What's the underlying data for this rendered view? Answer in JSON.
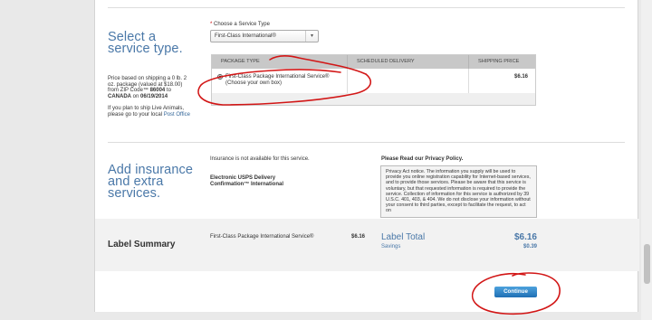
{
  "service": {
    "heading": "Select a service type.",
    "note_text": "Price based on shipping a 0 lb. 2 oz. package (valued at $18.00) from ZIP Code™ ",
    "note_zip": "86004",
    "note_to": " to ",
    "note_dest": "CANADA",
    "note_on": " on ",
    "note_date": "06/19/2014",
    "live_text": "If you plan to ship Live Animals, please go to your local ",
    "live_link": "Post Office",
    "select_label_req": "*",
    "select_label": "Choose a Service Type",
    "select_value": "First-Class International®",
    "columns": [
      "PACKAGE TYPE",
      "SCHEDULED DELIVERY",
      "SHIPPING PRICE"
    ],
    "row": {
      "name": "First-Class Package International Service®",
      "sub": "(Choose your own box)",
      "delivery": "",
      "price": "$6.16"
    }
  },
  "insurance": {
    "heading": "Add insurance and extra services.",
    "not_available": "Insurance is not available for this service.",
    "extra_service": "Electronic USPS Delivery Confirmation™ International",
    "privacy_title": "Please Read our Privacy Policy.",
    "privacy_text": "Privacy Act notice. The information you supply will be used to provide you online registration capability for Internet-based services, and to provide those services. Please be aware that this service is voluntary, but that requested information is required to provide the service. Collection of information for this service is authorized by 39 U.S.C. 401, 403, & 404. We do not disclose your information without your consent to third parties, except to facilitate the request, to act on"
  },
  "summary": {
    "heading": "Label Summary",
    "service": "First-Class Package International Service®",
    "service_price": "$6.16",
    "total_label": "Label Total",
    "total_value": "$6.16",
    "savings_label": "Savings",
    "savings_value": "$0.39"
  },
  "actions": {
    "continue_label": "Continue"
  },
  "colors": {
    "heading": "#4a78a8",
    "annotation": "#d21616",
    "button": "#2a7fc4"
  }
}
